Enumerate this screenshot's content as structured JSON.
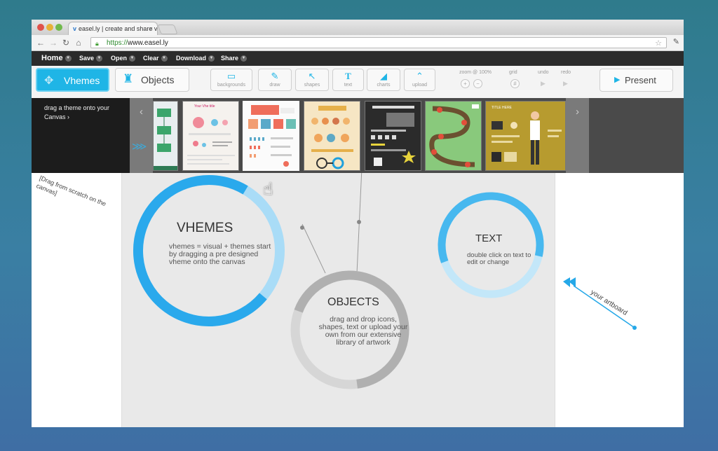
{
  "browser": {
    "tab_title": "easel.ly | create and share vis",
    "tab_close": "×",
    "url_scheme": "https://",
    "url_host": "www.easel.ly"
  },
  "menubar": {
    "items": [
      {
        "label": "Home"
      },
      {
        "label": "Save"
      },
      {
        "label": "Open"
      },
      {
        "label": "Clear"
      },
      {
        "label": "Download"
      },
      {
        "label": "Share"
      }
    ]
  },
  "toolbar": {
    "vhemes_label": "Vhemes",
    "objects_label": "Objects",
    "tools": [
      {
        "label": "backgrounds",
        "icon": "backgrounds-icon"
      },
      {
        "label": "draw",
        "icon": "pencil-icon"
      },
      {
        "label": "shapes",
        "icon": "arrow-icon"
      },
      {
        "label": "text",
        "icon": "text-icon"
      },
      {
        "label": "charts",
        "icon": "chart-icon"
      },
      {
        "label": "upload",
        "icon": "upload-icon"
      }
    ],
    "zoom_label": "zoom @ 100%",
    "grid_label": "grid",
    "undo_label": "undo",
    "redo_label": "redo",
    "present_label": "Present"
  },
  "drawer": {
    "hint_line1": "drag a theme onto your",
    "hint_line2": "Canvas ›",
    "prev_arrow": "‹",
    "next_arrow": "›",
    "thumb_titles": [
      "Your Vhe title",
      "",
      "",
      "",
      "",
      "TITLE HERE"
    ]
  },
  "canvas": {
    "left_annotation": "[Drag from scratch on the canvas]",
    "vhemes": {
      "title": "VHEMES",
      "body": "vhemes = visual + themes start by dragging a pre designed vheme onto the canvas"
    },
    "objects": {
      "title": "OBJECTS",
      "body": "drag and drop icons, shapes, text or upload your own from our extensive library of artwork"
    },
    "text": {
      "title": "TEXT",
      "body": "double click on text to edit or change"
    },
    "artboard_label": "your artboard"
  },
  "colors": {
    "accent": "#1fb5e6",
    "menubar": "#2b2b2b",
    "drawer": "#4a4a4a",
    "canvas": "#e9e9e9",
    "ring_grey": "#b5b5b5"
  }
}
